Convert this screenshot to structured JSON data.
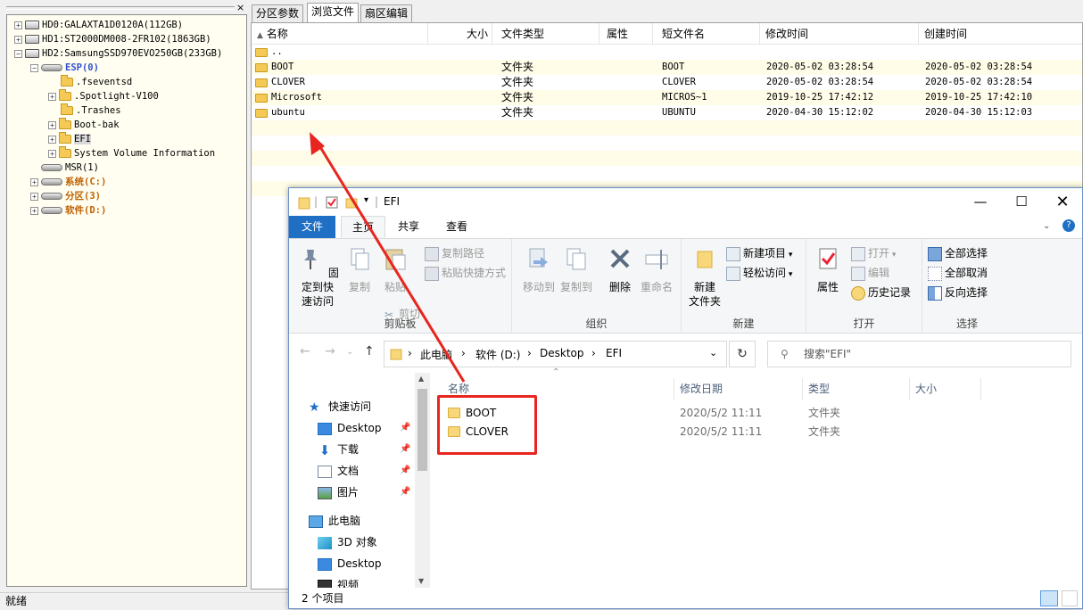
{
  "tree": {
    "close_glyph": "×",
    "nodes": [
      {
        "label": "HD0:GALAXTA1D0120A(112GB)",
        "kind": "disk"
      },
      {
        "label": "HD1:ST2000DM008-2FR102(1863GB)",
        "kind": "disk"
      },
      {
        "label": "HD2:SamsungSSD970EVO250GB(233GB)",
        "kind": "disk"
      },
      {
        "label": "ESP(0)",
        "kind": "part"
      },
      {
        "label": ".fseventsd",
        "kind": "folder"
      },
      {
        "label": ".Spotlight-V100",
        "kind": "folder"
      },
      {
        "label": ".Trashes",
        "kind": "folder"
      },
      {
        "label": "Boot-bak",
        "kind": "folder"
      },
      {
        "label": "EFI",
        "kind": "folder"
      },
      {
        "label": "System Volume Information",
        "kind": "folder"
      },
      {
        "label": "MSR(1)",
        "kind": "part"
      },
      {
        "label": "系统(C:)",
        "kind": "part"
      },
      {
        "label": "分区(3)",
        "kind": "part"
      },
      {
        "label": "软件(D:)",
        "kind": "part"
      }
    ]
  },
  "status": {
    "text": "就绪"
  },
  "dg": {
    "tabs": [
      "分区参数",
      "浏览文件",
      "扇区编辑"
    ],
    "columns": [
      "名称",
      "大小",
      "文件类型",
      "属性",
      "短文件名",
      "修改时间",
      "创建时间"
    ],
    "rows": [
      {
        "name": "..",
        "size": "",
        "type": "",
        "attr": "",
        "short": "",
        "mtime": "",
        "ctime": ""
      },
      {
        "name": "BOOT",
        "size": "",
        "type": "文件夹",
        "attr": "",
        "short": "BOOT",
        "mtime": "2020-05-02 03:28:54",
        "ctime": "2020-05-02 03:28:54"
      },
      {
        "name": "CLOVER",
        "size": "",
        "type": "文件夹",
        "attr": "",
        "short": "CLOVER",
        "mtime": "2020-05-02 03:28:54",
        "ctime": "2020-05-02 03:28:54"
      },
      {
        "name": "Microsoft",
        "size": "",
        "type": "文件夹",
        "attr": "",
        "short": "MICROS~1",
        "mtime": "2019-10-25 17:42:12",
        "ctime": "2019-10-25 17:42:10"
      },
      {
        "name": "ubuntu",
        "size": "",
        "type": "文件夹",
        "attr": "",
        "short": "UBUNTU",
        "mtime": "2020-04-30 15:12:02",
        "ctime": "2020-04-30 15:12:03"
      }
    ]
  },
  "explorer": {
    "title": "EFI",
    "ribbon_tabs": [
      "文件",
      "主页",
      "共享",
      "查看"
    ],
    "ribbon": {
      "pin": "固定到快\n速访问",
      "copy": "复制",
      "paste": "粘贴",
      "copy_path": "复制路径",
      "paste_shortcut": "粘贴快捷方式",
      "cut": "剪切",
      "clipboard": "剪贴板",
      "move_to": "移动到",
      "copy_to": "复制到",
      "delete": "删除",
      "rename": "重命名",
      "organize": "组织",
      "new_folder": "新建\n文件夹",
      "new_item": "新建项目",
      "easy_access": "轻松访问",
      "new_group": "新建",
      "properties": "属性",
      "open": "打开",
      "edit": "编辑",
      "history": "历史记录",
      "open_group": "打开",
      "select_all": "全部选择",
      "select_none": "全部取消",
      "invert": "反向选择",
      "select_group": "选择"
    },
    "breadcrumb": [
      "此电脑",
      "软件 (D:)",
      "Desktop",
      "EFI"
    ],
    "search_placeholder": "搜索\"EFI\"",
    "nav": [
      {
        "label": "快速访问",
        "icon": "star-icon",
        "pinned": false
      },
      {
        "label": "Desktop",
        "icon": "desktop-icon",
        "pinned": true
      },
      {
        "label": "下载",
        "icon": "download-icon",
        "pinned": true
      },
      {
        "label": "文档",
        "icon": "document-icon",
        "pinned": true
      },
      {
        "label": "图片",
        "icon": "picture-icon",
        "pinned": true
      },
      {
        "label": "此电脑",
        "icon": "computer-icon",
        "pinned": false
      },
      {
        "label": "3D 对象",
        "icon": "cube-icon",
        "pinned": false
      },
      {
        "label": "Desktop",
        "icon": "desktop-icon",
        "pinned": false
      },
      {
        "label": "视频",
        "icon": "video-icon",
        "pinned": false
      }
    ],
    "columns": [
      "名称",
      "修改日期",
      "类型",
      "大小"
    ],
    "files": [
      {
        "name": "BOOT",
        "date": "2020/5/2 11:11",
        "type": "文件夹"
      },
      {
        "name": "CLOVER",
        "date": "2020/5/2 11:11",
        "type": "文件夹"
      }
    ],
    "status": "2 个项目"
  },
  "colors": {
    "accent": "#1f6fc5",
    "annotation": "#e8251f",
    "tree_orange": "#c06000"
  }
}
